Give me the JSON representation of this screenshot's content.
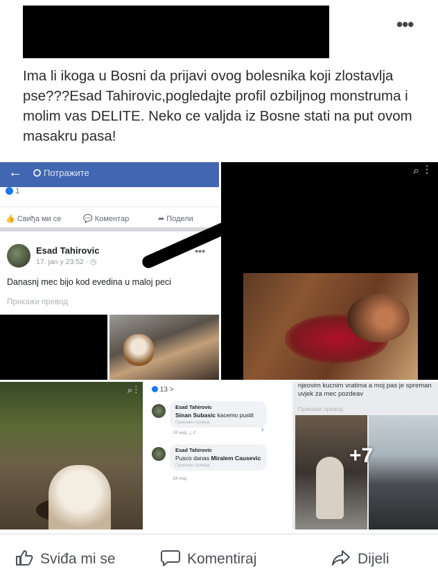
{
  "post": {
    "text": "Ima li ikoga u Bosni da prijavi ovog bolesnika koji zlostavlja pse???Esad Tahirovic,pogledajte profil ozbiljnog monstruma i molim vas DELITE. Neko ce valjda iz Bosne stati na put ovom masakru pasa!",
    "more_icon": "more-dots-icon"
  },
  "screenshot_post": {
    "search_placeholder": "Потражите",
    "like_count": "1",
    "like_label": "Свиђа ми се",
    "comment_label": "Коментар",
    "share_label": "Подели",
    "author": "Esad Tahirovic",
    "date": "17. jan у 23:52 · ◷",
    "body": "Danasnj mec bijo kod evedina u maloj peci",
    "translate": "Прикажи превод"
  },
  "comments_screenshot": {
    "reactions": "13 >",
    "comments": [
      {
        "name": "Esad Tahirovic",
        "mention": "Sinan Subasic",
        "text": "kacemo pustit",
        "translate": "Прикажи превод",
        "meta": "18 нед.    ⟂ 2",
        "reaction": "1"
      },
      {
        "name": "Esad Tahirovic",
        "text": "Pusco danas",
        "mention": "Miralem Causevic",
        "translate": "Прикажи превод",
        "meta": "18 нед."
      }
    ]
  },
  "photo5": {
    "text": "njeovim kucnim vratima a moj pas je spreman uvjek za mec pozdeav",
    "translate": "Прикажи превод",
    "more_count": "+7"
  },
  "actions": {
    "like": "Sviđa mi se",
    "comment": "Komentiraj",
    "share": "Dijeli"
  }
}
